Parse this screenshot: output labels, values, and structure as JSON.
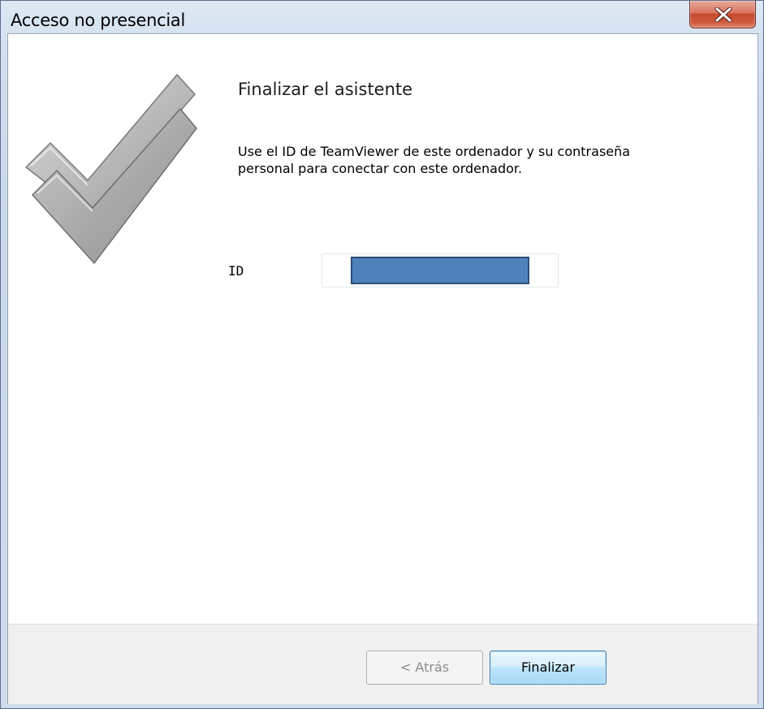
{
  "window": {
    "title": "Acceso no presencial"
  },
  "content": {
    "heading": "Finalizar el asistente",
    "description": "Use el ID de TeamViewer de este ordenador y su contraseña personal para conectar con este ordenador.",
    "id_label": "ID",
    "id_value": ""
  },
  "buttons": {
    "back_label": "< Atrás",
    "finish_label": "Finalizar"
  },
  "icons": {
    "close": "close-icon",
    "checkmark": "checkmark-icon"
  },
  "colors": {
    "id_redaction": "#4f81bd",
    "close_button": "#c44a2f",
    "finish_border": "#3c7fb1"
  }
}
